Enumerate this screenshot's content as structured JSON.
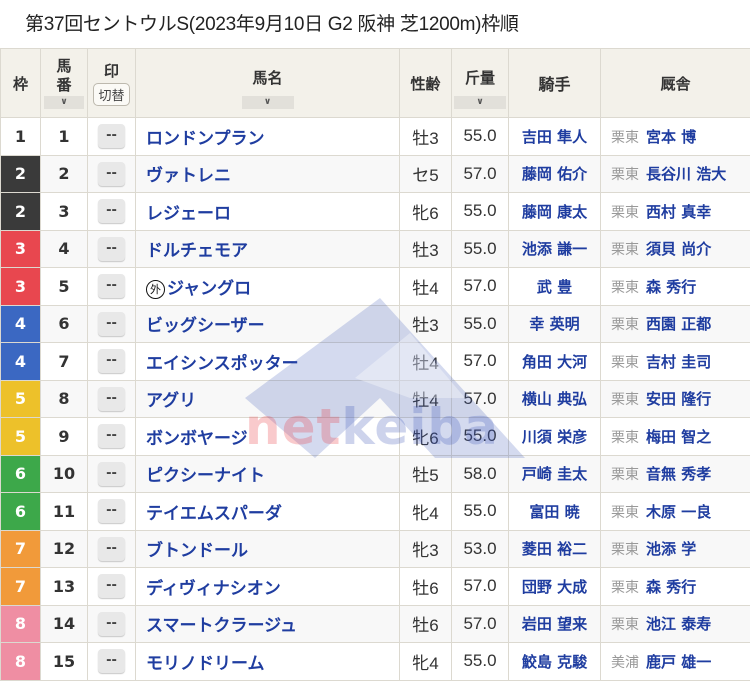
{
  "title": "第37回セントウルS(2023年9月10日 G2 阪神 芝1200m)枠順",
  "header": {
    "waku": "枠",
    "umaban": "馬番",
    "mark": "印",
    "mark_toggle": "切替",
    "name": "馬名",
    "sexage": "性齢",
    "weight": "斤量",
    "jockey": "騎手",
    "trainer": "厩舎",
    "sort_icon": "∨"
  },
  "waku_colors": {
    "1": {
      "bg": "#ffffff",
      "fg": "#333333"
    },
    "2": {
      "bg": "#3a3a3a",
      "fg": "#ffffff"
    },
    "3": {
      "bg": "#e8474f",
      "fg": "#ffffff"
    },
    "4": {
      "bg": "#3b68c2",
      "fg": "#ffffff"
    },
    "5": {
      "bg": "#edc12a",
      "fg": "#ffffff"
    },
    "6": {
      "bg": "#3da84a",
      "fg": "#ffffff"
    },
    "7": {
      "bg": "#f19a3a",
      "fg": "#ffffff"
    },
    "8": {
      "bg": "#ef8ea3",
      "fg": "#ffffff"
    }
  },
  "mark_default": "--",
  "foreign_badge": "外",
  "horses": [
    {
      "waku": "1",
      "umaban": "1",
      "name": "ロンドンプラン",
      "foreign": false,
      "sexage": "牡3",
      "weight": "55.0",
      "jockey": "吉田 隼人",
      "region": "栗東",
      "trainer": "宮本 博"
    },
    {
      "waku": "2",
      "umaban": "2",
      "name": "ヴァトレニ",
      "foreign": false,
      "sexage": "セ5",
      "weight": "57.0",
      "jockey": "藤岡 佑介",
      "region": "栗東",
      "trainer": "長谷川 浩大"
    },
    {
      "waku": "2",
      "umaban": "3",
      "name": "レジェーロ",
      "foreign": false,
      "sexage": "牝6",
      "weight": "55.0",
      "jockey": "藤岡 康太",
      "region": "栗東",
      "trainer": "西村 真幸"
    },
    {
      "waku": "3",
      "umaban": "4",
      "name": "ドルチェモア",
      "foreign": false,
      "sexage": "牡3",
      "weight": "55.0",
      "jockey": "池添 謙一",
      "region": "栗東",
      "trainer": "須貝 尚介"
    },
    {
      "waku": "3",
      "umaban": "5",
      "name": "ジャングロ",
      "foreign": true,
      "sexage": "牡4",
      "weight": "57.0",
      "jockey": "武 豊",
      "region": "栗東",
      "trainer": "森 秀行"
    },
    {
      "waku": "4",
      "umaban": "6",
      "name": "ビッグシーザー",
      "foreign": false,
      "sexage": "牡3",
      "weight": "55.0",
      "jockey": "幸 英明",
      "region": "栗東",
      "trainer": "西園 正都"
    },
    {
      "waku": "4",
      "umaban": "7",
      "name": "エイシンスポッター",
      "foreign": false,
      "sexage": "牡4",
      "weight": "57.0",
      "jockey": "角田 大河",
      "region": "栗東",
      "trainer": "吉村 圭司"
    },
    {
      "waku": "5",
      "umaban": "8",
      "name": "アグリ",
      "foreign": false,
      "sexage": "牡4",
      "weight": "57.0",
      "jockey": "横山 典弘",
      "region": "栗東",
      "trainer": "安田 隆行"
    },
    {
      "waku": "5",
      "umaban": "9",
      "name": "ボンボヤージ",
      "foreign": false,
      "sexage": "牝6",
      "weight": "55.0",
      "jockey": "川須 栄彦",
      "region": "栗東",
      "trainer": "梅田 智之"
    },
    {
      "waku": "6",
      "umaban": "10",
      "name": "ピクシーナイト",
      "foreign": false,
      "sexage": "牡5",
      "weight": "58.0",
      "jockey": "戸崎 圭太",
      "region": "栗東",
      "trainer": "音無 秀孝"
    },
    {
      "waku": "6",
      "umaban": "11",
      "name": "テイエムスパーダ",
      "foreign": false,
      "sexage": "牝4",
      "weight": "55.0",
      "jockey": "富田 暁",
      "region": "栗東",
      "trainer": "木原 一良"
    },
    {
      "waku": "7",
      "umaban": "12",
      "name": "ブトンドール",
      "foreign": false,
      "sexage": "牝3",
      "weight": "53.0",
      "jockey": "菱田 裕二",
      "region": "栗東",
      "trainer": "池添 学"
    },
    {
      "waku": "7",
      "umaban": "13",
      "name": "ディヴィナシオン",
      "foreign": false,
      "sexage": "牡6",
      "weight": "57.0",
      "jockey": "団野 大成",
      "region": "栗東",
      "trainer": "森 秀行"
    },
    {
      "waku": "8",
      "umaban": "14",
      "name": "スマートクラージュ",
      "foreign": false,
      "sexage": "牡6",
      "weight": "57.0",
      "jockey": "岩田 望来",
      "region": "栗東",
      "trainer": "池江 泰寿"
    },
    {
      "waku": "8",
      "umaban": "15",
      "name": "モリノドリーム",
      "foreign": false,
      "sexage": "牝4",
      "weight": "55.0",
      "jockey": "鮫島 克駿",
      "region": "美浦",
      "trainer": "鹿戸 雄一"
    }
  ],
  "watermark": {
    "part1": "net",
    "part2": "keiba"
  }
}
